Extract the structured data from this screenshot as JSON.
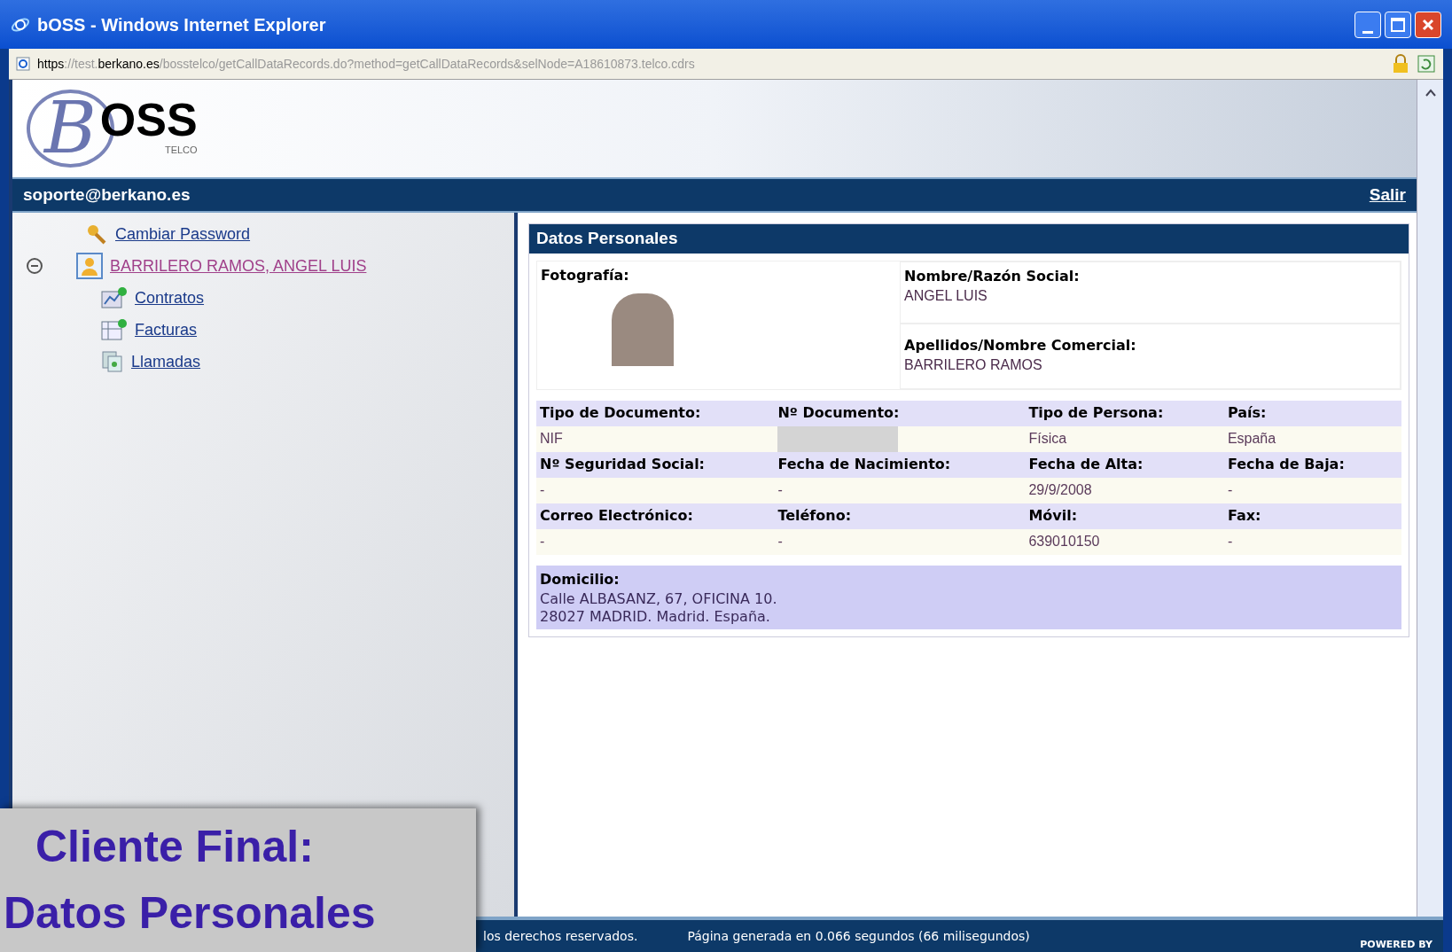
{
  "window": {
    "title": "bOSS - Windows Internet Explorer",
    "address": {
      "scheme": "https",
      "host_prefix": "://test.",
      "domain": "berkano.es",
      "path": "/bosstelco/getCallDataRecords.do?method=getCallDataRecords&selNode=A18610873.telco.cdrs"
    }
  },
  "header": {
    "logo_initial": "B",
    "logo_text": "OSS",
    "logo_sub": "TELCO",
    "user": "soporte@berkano.es",
    "logout": "Salir"
  },
  "tree": [
    {
      "label": "Cambiar Password",
      "kind": "key"
    },
    {
      "label": "BARRILERO RAMOS, ANGEL LUIS",
      "kind": "client",
      "expanded": true,
      "visited": true,
      "children": [
        {
          "label": "Contratos",
          "kind": "contract"
        },
        {
          "label": "Facturas",
          "kind": "invoice"
        },
        {
          "label": "Llamadas",
          "kind": "calls"
        }
      ]
    }
  ],
  "panel": {
    "title": "Datos Personales",
    "photo_label": "Fotografía:",
    "names": [
      {
        "label": "Nombre/Razón Social:",
        "value": "ANGEL LUIS"
      },
      {
        "label": "Apellidos/Nombre Comercial:",
        "value": "BARRILERO RAMOS"
      }
    ],
    "grid": [
      [
        {
          "label": "Tipo de Documento:",
          "value": "NIF"
        },
        {
          "label": "Nº Documento:",
          "redacted": true
        },
        {
          "label": "Tipo de Persona:",
          "value": "Física"
        },
        {
          "label": "País:",
          "value": "España"
        }
      ],
      [
        {
          "label": "Nº Seguridad Social:",
          "value": "-"
        },
        {
          "label": "Fecha de Nacimiento:",
          "value": "-"
        },
        {
          "label": "Fecha de Alta:",
          "value": "29/9/2008"
        },
        {
          "label": "Fecha de Baja:",
          "value": "-"
        }
      ],
      [
        {
          "label": "Correo Electrónico:",
          "value": "-"
        },
        {
          "label": "Teléfono:",
          "value": "-"
        },
        {
          "label": "Móvil:",
          "value": "639010150"
        },
        {
          "label": "Fax:",
          "value": "-"
        }
      ]
    ],
    "address": {
      "label": "Domicilio:",
      "lines": [
        "Calle ALBASANZ, 67, OFICINA 10.",
        "28027 MADRID. Madrid. España."
      ]
    }
  },
  "footer": {
    "copyright": "los derechos reservados.",
    "generated": "Página generada en 0.066 segundos (66 milisegundos)",
    "powered": "POWERED BY"
  },
  "caption": [
    "Cliente Final:",
    "Datos Personales"
  ]
}
